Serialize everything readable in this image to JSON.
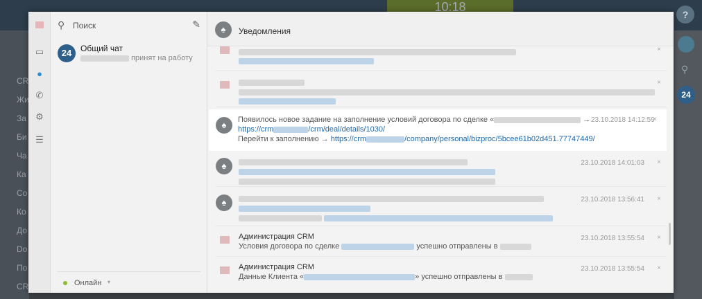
{
  "background": {
    "clock": "10:18",
    "help": "?",
    "right_badge": "24",
    "left_menu": [
      "CRM",
      "Жи",
      "За",
      "Би",
      "Ча",
      "Ка",
      "Со",
      "Ко",
      "До",
      "Do",
      "По",
      "CR"
    ]
  },
  "rail": {
    "icons": [
      "chat-icon",
      "bell-icon",
      "phone-icon",
      "gear-icon",
      "list-icon"
    ]
  },
  "search": {
    "placeholder": "Поиск"
  },
  "chat": {
    "avatar": "24",
    "name": "Общий чат",
    "preview_suffix": "принят на работу"
  },
  "status": {
    "label": "Онлайн",
    "caret": "▾"
  },
  "notifications": {
    "title": "Уведомления",
    "highlight": {
      "line1": "Появилось новое задание на заполнение условий договора по сделке «",
      "arrow": "→",
      "link1_a": "https://crm",
      "link1_b": "/crm/deal/details/1030/",
      "line3_prefix": "Перейти к заполнению →",
      "link2_a": "https://crm",
      "link2_b": "/company/personal/bizproc/5bcee61b02d451.77747449/",
      "date": "23.10.2018 14:12:59",
      "close": "×"
    },
    "rows": [
      {
        "date": "23.10.2018 14:01:03",
        "close": "×"
      },
      {
        "date": "23.10.2018 13:56:41",
        "close": "×"
      },
      {
        "author": "Администрация CRM",
        "text_a": "Условия договора по сделке",
        "text_b": "успешно отправлены в",
        "date": "23.10.2018 13:55:54",
        "close": "×"
      },
      {
        "author": "Администрация CRM",
        "text_a": "Данные Клиента «",
        "text_b": "» успешно отправлены в",
        "date": "23.10.2018 13:55:54",
        "close": "×"
      }
    ],
    "top_rows": [
      {
        "close": "×"
      },
      {
        "close": "×"
      }
    ]
  }
}
